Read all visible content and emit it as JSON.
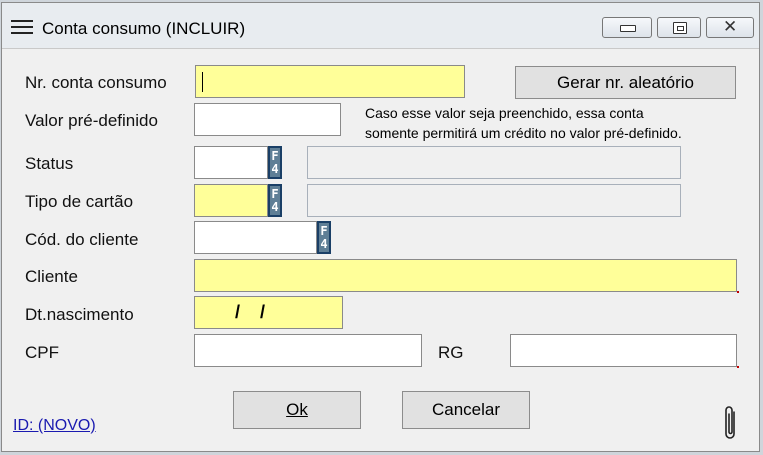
{
  "window": {
    "title": "Conta consumo (INCLUIR)",
    "controls": [
      "minimize",
      "maximize",
      "close"
    ]
  },
  "form": {
    "nr_conta": {
      "label": "Nr. conta consumo",
      "value": ""
    },
    "gerar_button": "Gerar nr. aleatório",
    "valor_pre": {
      "label": "Valor pré-definido",
      "value": ""
    },
    "note_line1": "Caso esse valor seja preenchido, essa conta",
    "note_line2": "somente permitirá um crédito no valor pré-definido.",
    "status": {
      "label": "Status",
      "code": "",
      "description": ""
    },
    "tipo_cartao": {
      "label": "Tipo de cartão",
      "code": "",
      "description": ""
    },
    "cod_cliente": {
      "label": "Cód. do cliente",
      "value": ""
    },
    "cliente": {
      "label": "Cliente",
      "value": ""
    },
    "dt_nascimento": {
      "label": "Dt.nascimento",
      "value": "  /    /"
    },
    "cpf": {
      "label": "CPF",
      "value": ""
    },
    "rg": {
      "label": "RG",
      "value": ""
    },
    "lookup_key": "F4"
  },
  "buttons": {
    "ok": "Ok",
    "cancelar": "Cancelar"
  },
  "footer": {
    "id_link": "ID: (NOVO)",
    "attachment_icon": "paperclip-icon"
  },
  "colors": {
    "required_field": "#ffff99",
    "lookup_key": "#1a3f66",
    "link": "#1a1ab0"
  }
}
